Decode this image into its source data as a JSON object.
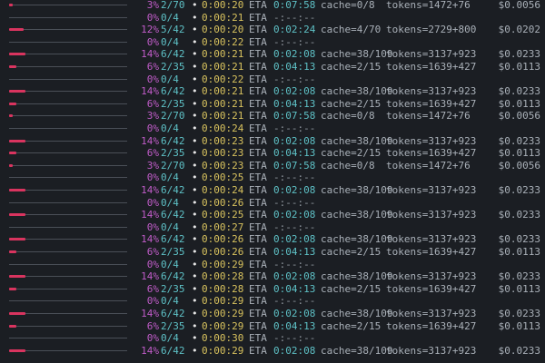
{
  "window": {
    "title": ""
  },
  "colors": {
    "background": "#1b1e23",
    "bar_fill": "#d9345f",
    "bar_track": "#4a4f57",
    "percent": "#c05cc8",
    "count": "#5ec1c6",
    "elapsed": "#d8c25e",
    "eta": "#5ec1c6",
    "text": "#a9b0b8"
  },
  "rows": [
    {
      "fill": 0.03,
      "percent": "3%",
      "count": "2/70",
      "elapsed": "0:00:20",
      "eta": "0:07:58",
      "cache": "cache=0/8",
      "tokens": "tokens=1472+76",
      "cost": "$0.0056"
    },
    {
      "fill": 0,
      "percent": "0%",
      "count": "0/4",
      "elapsed": "0:00:21",
      "eta": "-:--:--",
      "cache": "",
      "tokens": "",
      "cost": ""
    },
    {
      "fill": 0.12,
      "percent": "12%",
      "count": "5/42",
      "elapsed": "0:00:20",
      "eta": "0:02:24",
      "cache": "cache=4/70",
      "tokens": "tokens=2729+800",
      "cost": "$0.0202"
    },
    {
      "fill": 0,
      "percent": "0%",
      "count": "0/4",
      "elapsed": "0:00:22",
      "eta": "-:--:--",
      "cache": "",
      "tokens": "",
      "cost": ""
    },
    {
      "fill": 0.14,
      "percent": "14%",
      "count": "6/42",
      "elapsed": "0:00:21",
      "eta": "0:02:08",
      "cache": "cache=38/109",
      "tokens": "tokens=3137+923",
      "cost": "$0.0233"
    },
    {
      "fill": 0.06,
      "percent": "6%",
      "count": "2/35",
      "elapsed": "0:00:21",
      "eta": "0:04:13",
      "cache": "cache=2/15",
      "tokens": "tokens=1639+427",
      "cost": "$0.0113"
    },
    {
      "fill": 0,
      "percent": "0%",
      "count": "0/4",
      "elapsed": "0:00:22",
      "eta": "-:--:--",
      "cache": "",
      "tokens": "",
      "cost": ""
    },
    {
      "fill": 0.14,
      "percent": "14%",
      "count": "6/42",
      "elapsed": "0:00:21",
      "eta": "0:02:08",
      "cache": "cache=38/109",
      "tokens": "tokens=3137+923",
      "cost": "$0.0233"
    },
    {
      "fill": 0.06,
      "percent": "6%",
      "count": "2/35",
      "elapsed": "0:00:21",
      "eta": "0:04:13",
      "cache": "cache=2/15",
      "tokens": "tokens=1639+427",
      "cost": "$0.0113"
    },
    {
      "fill": 0.03,
      "percent": "3%",
      "count": "2/70",
      "elapsed": "0:00:21",
      "eta": "0:07:58",
      "cache": "cache=0/8",
      "tokens": "tokens=1472+76",
      "cost": "$0.0056"
    },
    {
      "fill": 0,
      "percent": "0%",
      "count": "0/4",
      "elapsed": "0:00:24",
      "eta": "-:--:--",
      "cache": "",
      "tokens": "",
      "cost": ""
    },
    {
      "fill": 0.14,
      "percent": "14%",
      "count": "6/42",
      "elapsed": "0:00:23",
      "eta": "0:02:08",
      "cache": "cache=38/109",
      "tokens": "tokens=3137+923",
      "cost": "$0.0233"
    },
    {
      "fill": 0.06,
      "percent": "6%",
      "count": "2/35",
      "elapsed": "0:00:23",
      "eta": "0:04:13",
      "cache": "cache=2/15",
      "tokens": "tokens=1639+427",
      "cost": "$0.0113"
    },
    {
      "fill": 0.03,
      "percent": "3%",
      "count": "2/70",
      "elapsed": "0:00:23",
      "eta": "0:07:58",
      "cache": "cache=0/8",
      "tokens": "tokens=1472+76",
      "cost": "$0.0056"
    },
    {
      "fill": 0,
      "percent": "0%",
      "count": "0/4",
      "elapsed": "0:00:25",
      "eta": "-:--:--",
      "cache": "",
      "tokens": "",
      "cost": ""
    },
    {
      "fill": 0.14,
      "percent": "14%",
      "count": "6/42",
      "elapsed": "0:00:24",
      "eta": "0:02:08",
      "cache": "cache=38/109",
      "tokens": "tokens=3137+923",
      "cost": "$0.0233"
    },
    {
      "fill": 0,
      "percent": "0%",
      "count": "0/4",
      "elapsed": "0:00:26",
      "eta": "-:--:--",
      "cache": "",
      "tokens": "",
      "cost": ""
    },
    {
      "fill": 0.14,
      "percent": "14%",
      "count": "6/42",
      "elapsed": "0:00:25",
      "eta": "0:02:08",
      "cache": "cache=38/109",
      "tokens": "tokens=3137+923",
      "cost": "$0.0233"
    },
    {
      "fill": 0,
      "percent": "0%",
      "count": "0/4",
      "elapsed": "0:00:27",
      "eta": "-:--:--",
      "cache": "",
      "tokens": "",
      "cost": ""
    },
    {
      "fill": 0.14,
      "percent": "14%",
      "count": "6/42",
      "elapsed": "0:00:26",
      "eta": "0:02:08",
      "cache": "cache=38/109",
      "tokens": "tokens=3137+923",
      "cost": "$0.0233"
    },
    {
      "fill": 0.06,
      "percent": "6%",
      "count": "2/35",
      "elapsed": "0:00:26",
      "eta": "0:04:13",
      "cache": "cache=2/15",
      "tokens": "tokens=1639+427",
      "cost": "$0.0113"
    },
    {
      "fill": 0,
      "percent": "0%",
      "count": "0/4",
      "elapsed": "0:00:29",
      "eta": "-:--:--",
      "cache": "",
      "tokens": "",
      "cost": ""
    },
    {
      "fill": 0.14,
      "percent": "14%",
      "count": "6/42",
      "elapsed": "0:00:28",
      "eta": "0:02:08",
      "cache": "cache=38/109",
      "tokens": "tokens=3137+923",
      "cost": "$0.0233"
    },
    {
      "fill": 0.06,
      "percent": "6%",
      "count": "2/35",
      "elapsed": "0:00:28",
      "eta": "0:04:13",
      "cache": "cache=2/15",
      "tokens": "tokens=1639+427",
      "cost": "$0.0113"
    },
    {
      "fill": 0,
      "percent": "0%",
      "count": "0/4",
      "elapsed": "0:00:29",
      "eta": "-:--:--",
      "cache": "",
      "tokens": "",
      "cost": ""
    },
    {
      "fill": 0.14,
      "percent": "14%",
      "count": "6/42",
      "elapsed": "0:00:29",
      "eta": "0:02:08",
      "cache": "cache=38/109",
      "tokens": "tokens=3137+923",
      "cost": "$0.0233"
    },
    {
      "fill": 0.06,
      "percent": "6%",
      "count": "2/35",
      "elapsed": "0:00:29",
      "eta": "0:04:13",
      "cache": "cache=2/15",
      "tokens": "tokens=1639+427",
      "cost": "$0.0113"
    },
    {
      "fill": 0,
      "percent": "0%",
      "count": "0/4",
      "elapsed": "0:00:30",
      "eta": "-:--:--",
      "cache": "",
      "tokens": "",
      "cost": ""
    },
    {
      "fill": 0.14,
      "percent": "14%",
      "count": "6/42",
      "elapsed": "0:00:29",
      "eta": "0:02:08",
      "cache": "cache=38/109",
      "tokens": "tokens=3137+923",
      "cost": "$0.0233"
    }
  ]
}
